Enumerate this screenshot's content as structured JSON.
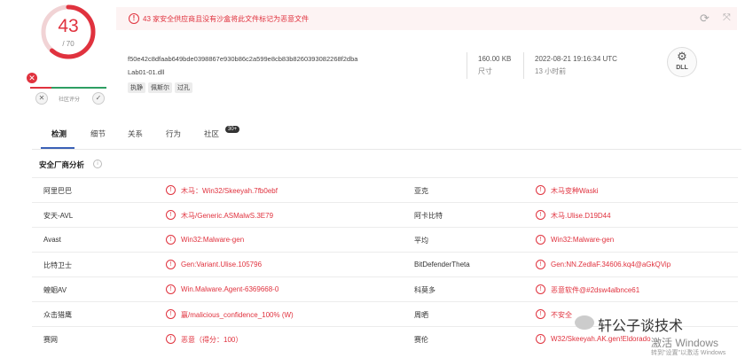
{
  "score": {
    "detections": "43",
    "total": "/ 70"
  },
  "community": {
    "label": "社区评分"
  },
  "alert": {
    "text": "43 家安全供应商且没有沙盒将此文件标记为恶意文件"
  },
  "file": {
    "hash": "f50e42c8dfaab649bde0398867e930b86c2a599e8cb83b8260393082268f2dba",
    "name": "Lab01-01.dll",
    "tags": [
      "执静",
      "佩斯尔",
      "过孔"
    ],
    "size_value": "160.00 KB",
    "size_label": "尺寸",
    "date_value": "2022-08-21 19:16:34 UTC",
    "date_label": "13 小时前",
    "type_icon": "DLL"
  },
  "tabs": [
    {
      "label": "检测"
    },
    {
      "label": "细节"
    },
    {
      "label": "关系"
    },
    {
      "label": "行为"
    },
    {
      "label": "社区",
      "badge": "30+"
    }
  ],
  "section": {
    "title": "安全厂商分析"
  },
  "vendors": [
    {
      "left_name": "阿里巴巴",
      "left_result": "木马：Win32/Skeeyah.7fb0ebf",
      "right_name": "亚克",
      "right_result": "木马变种Waski"
    },
    {
      "left_name": "安天-AVL",
      "left_result": "木马/Generic.ASMalwS.3E79",
      "right_name": "阿卡比特",
      "right_result": "木马.Ulise.D19D44"
    },
    {
      "left_name": "Avast",
      "left_result": "Win32:Malware-gen",
      "right_name": "平均",
      "right_result": "Win32:Malware-gen"
    },
    {
      "left_name": "比特卫士",
      "left_result": "Gen:Variant.Ulise.105796",
      "right_name": "BitDefenderTheta",
      "right_result": "Gen:NN.ZedlaF.34606.kq4@aGkQVip"
    },
    {
      "left_name": "蝗蛔AV",
      "left_result": "Win.Malware.Agent-6369668-0",
      "right_name": "科莫多",
      "right_result": "恶意软件@#2dsw4albnce61"
    },
    {
      "left_name": "众击猎鹰",
      "left_result": "赢/malicious_confidence_100% (W)",
      "right_name": "周晒",
      "right_result": "不安全"
    },
    {
      "left_name": "赛网",
      "left_result": "恶意（得分：100）",
      "right_name": "赛伦",
      "right_result": "W32/Skeeyah.AK.gen!Eldorado"
    }
  ],
  "watermark": {
    "brand": "轩公子谈技术",
    "activate": "激活 Windows",
    "goto": "转到\"设置\"以激活 Windows"
  },
  "colors": {
    "danger": "#e0323e",
    "accent": "#3b61b6",
    "positive": "#2e9e62"
  }
}
